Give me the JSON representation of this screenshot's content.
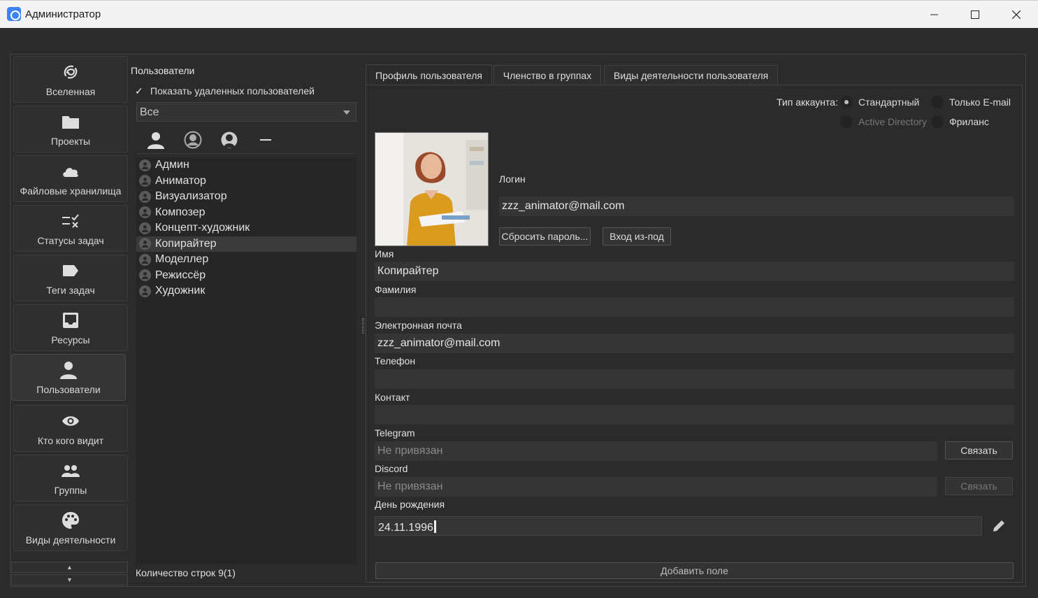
{
  "window": {
    "title": "Администратор",
    "minimize_icon": "minimize-icon",
    "maximize_icon": "maximize-icon",
    "close_icon": "close-icon"
  },
  "sidebar": {
    "items": [
      {
        "label": "Вселенная",
        "icon": "universe-icon"
      },
      {
        "label": "Проекты",
        "icon": "folder-icon"
      },
      {
        "label": "Файловые хранилища",
        "icon": "cloud-icon"
      },
      {
        "label": "Статусы задач",
        "icon": "task-status-icon"
      },
      {
        "label": "Теги задач",
        "icon": "tag-icon"
      },
      {
        "label": "Ресурсы",
        "icon": "inbox-icon"
      },
      {
        "label": "Пользователи",
        "icon": "user-icon"
      },
      {
        "label": "Кто кого видит",
        "icon": "eye-icon"
      },
      {
        "label": "Группы",
        "icon": "group-icon"
      },
      {
        "label": "Виды деятельности",
        "icon": "palette-icon"
      }
    ],
    "active": "Пользователи"
  },
  "users_panel": {
    "title": "Пользователи",
    "show_deleted_label": "Показать удаленных пользователей",
    "show_deleted_checked": true,
    "filter_value": "Все",
    "toolbar": [
      "add-user-icon",
      "user-circle-icon",
      "user-badge-icon",
      "remove-icon"
    ],
    "users": [
      "Админ",
      "Аниматор",
      "Визуализатор",
      "Композер",
      "Концепт-художник",
      "Копирайтер",
      "Моделлер",
      "Режиссёр",
      "Художник"
    ],
    "selected_user": "Копирайтер",
    "rows_count": "Количество строк 9(1)"
  },
  "tabs": [
    "Профиль пользователя",
    "Членство в группах",
    "Виды деятельности пользователя"
  ],
  "active_tab": "Профиль пользователя",
  "profile": {
    "account_type_label": "Тип аккаунта:",
    "account_types": {
      "standard": "Стандартный",
      "email_only": "Только E-mail",
      "active_directory": "Active Directory",
      "freelance": "Фриланс"
    },
    "selected_account_type": "Стандартный",
    "login_label": "Логин",
    "login_value": "zzz_animator@mail.com",
    "reset_password_button": "Сбросить пароль...",
    "login_as_button": "Вход из-под",
    "first_name_label": "Имя",
    "first_name_value": "Копирайтер",
    "last_name_label": "Фамилия",
    "last_name_value": "",
    "email_label": "Электронная почта",
    "email_value": "zzz_animator@mail.com",
    "phone_label": "Телефон",
    "phone_value": "",
    "contact_label": "Контакт",
    "contact_value": "",
    "telegram_label": "Telegram",
    "telegram_value": "Не привязан",
    "telegram_button": "Связать",
    "discord_label": "Discord",
    "discord_value": "Не привязан",
    "discord_button": "Связать",
    "birthday_label": "День рождения",
    "birthday_value": "24.11.1996",
    "add_field_button": "Добавить поле"
  }
}
